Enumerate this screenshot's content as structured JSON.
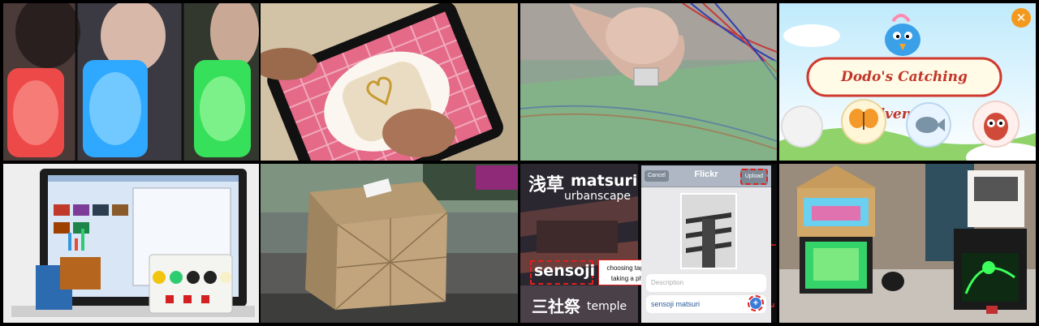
{
  "tiles": {
    "game": {
      "title": "Dodo's Catching Adventure",
      "close_icon": "close-icon"
    },
    "photo_app": {
      "tags": {
        "asakusa": "浅草",
        "matsuri": "matsuri",
        "urbanscape": "urbanscape",
        "sensoji": "sensoji",
        "sanja": "三社祭",
        "temple": "temple"
      },
      "callout_line1": "choosing tag and",
      "callout_line2": "taking a photo",
      "phone": {
        "nav_title": "Flickr",
        "cancel": "Cancel",
        "upload": "Upload",
        "description_placeholder": "Description",
        "tag_field": "sensoji matsuri"
      }
    }
  }
}
